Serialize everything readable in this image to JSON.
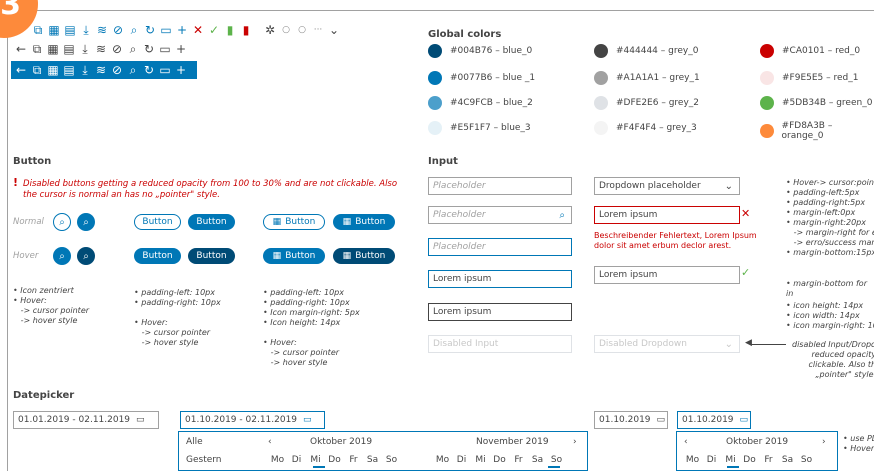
{
  "step": "3",
  "sections": {
    "global_colors": "Global colors",
    "button": "Button",
    "input": "Input",
    "datepicker": "Datepicker"
  },
  "colors": [
    {
      "hex": "#004B76",
      "label": "#004B76 – blue_0"
    },
    {
      "hex": "#444444",
      "label": "#444444 – grey_0"
    },
    {
      "hex": "#CA0101",
      "label": "#CA0101 – red_0"
    },
    {
      "hex": "#0077B6",
      "label": "#0077B6 – blue _1"
    },
    {
      "hex": "#A1A1A1",
      "label": "#A1A1A1 – grey_1"
    },
    {
      "hex": "#F9E5E5",
      "label": "#F9E5E5 – red_1"
    },
    {
      "hex": "#4C9FCB",
      "label": "#4C9FCB – blue_2"
    },
    {
      "hex": "#DFE2E6",
      "label": "#DFE2E6 – grey_2"
    },
    {
      "hex": "#5DB34B",
      "label": "#5DB34B – green_0"
    },
    {
      "hex": "#E5F1F7",
      "label": "#E5F1F7 – blue_3"
    },
    {
      "hex": "#F4F4F4",
      "label": "#F4F4F4 – grey_3"
    },
    {
      "hex": "#FD8A3B",
      "label": "#FD8A3B – orange_0"
    }
  ],
  "button": {
    "disabled_note_1": "Disabled buttons getting a reduced opacity from 100 to 30% and are not clickable. Also",
    "disabled_note_2": "the cursor is normal an has no „pointer\" style.",
    "normal": "Normal",
    "hover": "Hover",
    "label": "Button",
    "icon_notes": [
      "• Icon zentriert",
      "• Hover:",
      "   -> cursor pointer",
      "   -> hover style"
    ],
    "text_notes": [
      "• padding-left: 10px",
      "• padding-right: 10px",
      "",
      "• Hover:",
      "   -> cursor pointer",
      "   -> hover style"
    ],
    "icon_text_notes": [
      "• padding-left: 10px",
      "• padding-right: 10px",
      "• Icon margin-right: 5px",
      "• Icon height: 14px",
      "",
      "• Hover:",
      "   -> cursor pointer",
      "   -> hover style"
    ]
  },
  "input": {
    "placeholder": "Placeholder",
    "dropdown_placeholder": "Dropdown placeholder",
    "value": "Lorem ipsum",
    "disabled_input": "Disabled Input",
    "disabled_dropdown": "Disabled Dropdown",
    "error_1": "Beschreibender Fehlertext, Lorem Ipsum",
    "error_2": "dolor sit amet erbum declor arest.",
    "notes_a": [
      "• Hover-> cursor:pointer",
      "• padding-left:5px",
      "• padding-right:5px",
      "• margin-left:0px",
      "• margin-right:20px",
      "   -> margin-right for err",
      "   -> erro/success mark",
      "• margin-bottom:15px"
    ],
    "note_b": "• margin-bottom for in",
    "notes_c": [
      "• icon height: 14px",
      "• icon width: 14px",
      "• icon margin-right: 10"
    ],
    "disabled_notes": [
      "disabled Input/Dropd",
      "reduced opacity",
      "clickable. Also th",
      "„pointer\" style."
    ]
  },
  "datepicker": {
    "range_1": "01.01.2019  -  02.11.2019",
    "range_2": "01.10.2019  -  02.11.2019",
    "single_1": "01.10.2019",
    "single_2": "01.10.2019",
    "presets": [
      "Alle",
      "Gestern"
    ],
    "month_1": "Oktober 2019",
    "month_2": "November 2019",
    "month_3": "Oktober 2019",
    "weekdays": [
      "Mo",
      "Di",
      "Mi",
      "Do",
      "Fr",
      "Sa",
      "So"
    ],
    "prev": "‹",
    "next": "›",
    "right_notes": [
      "• use PL",
      "• Hover-"
    ]
  }
}
